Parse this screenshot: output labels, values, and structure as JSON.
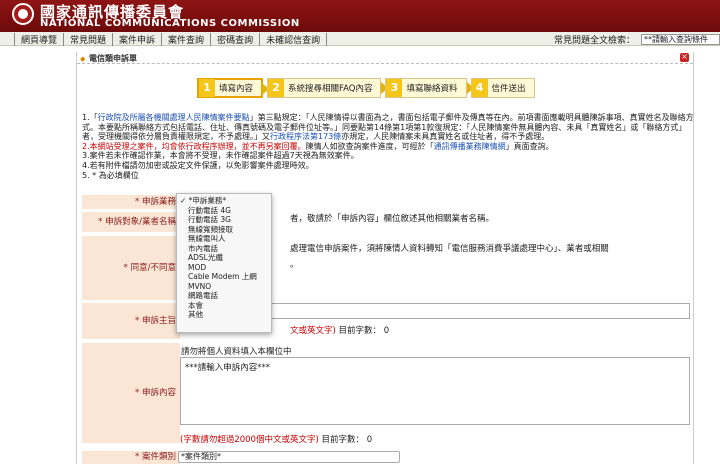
{
  "header": {
    "title_zh": "國家通訊傳播委員會",
    "title_en": "NATIONAL COMMUNICATIONS COMMISSION"
  },
  "nav": {
    "items": [
      "網頁導覽",
      "常見問題",
      "案件申訴",
      "案件查詢",
      "密碼查詢",
      "未確認信查詢"
    ],
    "search_label": "常見問題全文檢索：",
    "search_value": "**請輸入查詢條件"
  },
  "panel": {
    "title": "電信類申訴單",
    "close_label": "×"
  },
  "steps": [
    {
      "num": "1",
      "label": "填寫內容"
    },
    {
      "num": "2",
      "label": "系統搜尋相關FAQ內容"
    },
    {
      "num": "3",
      "label": "填寫聯絡資料"
    },
    {
      "num": "4",
      "label": "信件送出"
    }
  ],
  "notes": {
    "n1_a": "1.「",
    "n1_link": "行政院及所屬各機關處理人民陳情案件要點",
    "n1_b": "」第三點規定：「人民陳情得以書面為之，書面包括電子郵件及傳真等在內。前項書面應載明具體陳訴事項、真實姓名及聯絡方式。本要點所稱聯絡方式包括電話、住址、傳真號碼及電子郵件位址等。」同要點第14條第1項第1款復規定：「人民陳情案件無具體內容、未具「真實姓名」或「聯絡方式」者，受理機關得依分層負責權限規定，不予處理。」又",
    "n1_link2": "行政程序法第173條",
    "n1_c": "亦規定，人民陳情案未具真實姓名或住址者，得不予處理。",
    "n2_red": "2.本網站受理之案件，均會依行政程序辦理，並不再另案回覆。",
    "n2_b": "陳情人如欲查詢案件進度，可經於「",
    "n2_link": "通訊傳播業務陳情網",
    "n2_c": "」頁面查詢。",
    "n3": "3.案件若未作確認作業，本會將不受理，未作確認案件超過7天視為無效案件。",
    "n4": "4.若有附件檔請勿加密或設定文件保護，以免影響案件處理時效。",
    "n5": "5. * 為必填欄位"
  },
  "form": {
    "business_label": "* 申訴業務",
    "target_label": "* 申訴對象/業者名稱",
    "target_hint": "者，敬請於「申訴內容」欄位敘述其他相關業者名稱。",
    "consent_label": "* 同意/不同意",
    "consent_hint": "處理電信申訴案件，須將陳情人資料轉知「電信服務消費爭議處理中心」、業者或相關",
    "consent_hint2": "。",
    "subject_label": "* 申訴主旨",
    "subject_counter_a": "文或英文字)",
    "subject_counter_b": "目前字數：",
    "subject_count": "0",
    "content_label": "* 申訴內容",
    "privacy_warning": "請勿將個人資料填入本欄位中",
    "content_placeholder": "***請輸入申訴內容***",
    "content_counter_a": "(字數請勿超過2000個中文或英文字)",
    "content_counter_b": "目前字數：",
    "content_count": "0",
    "category_label": "* 案件類別",
    "category_value": "*案件類別*"
  },
  "dropdown": {
    "options": [
      "*申訴業務*",
      "行動電話 4G",
      "行動電話 3G",
      "無線寬頻接取",
      "無線電叫人",
      "市內電話",
      "ADSL光纖",
      "MOD",
      "Cable Modem 上網",
      "MVNO",
      "網路電話",
      "本會",
      "其他"
    ],
    "checked_index": 0
  }
}
